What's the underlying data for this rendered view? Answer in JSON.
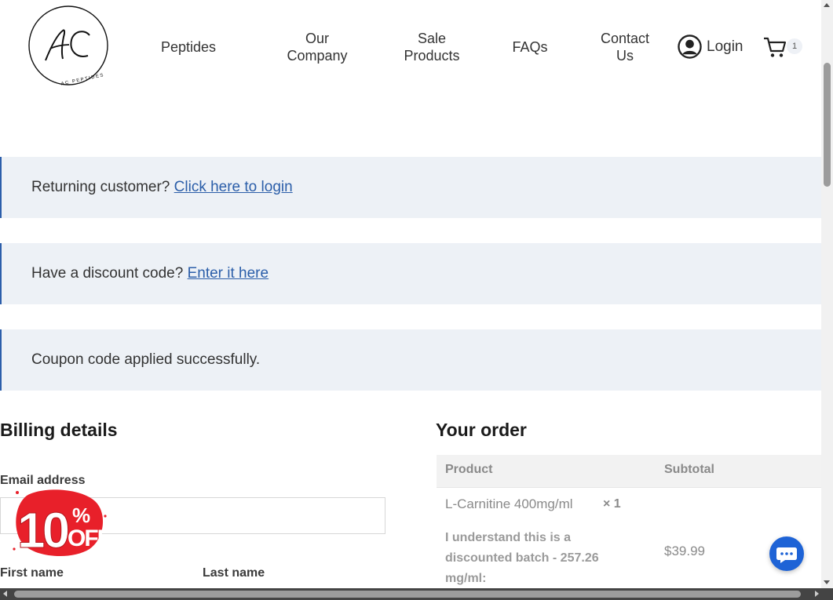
{
  "header": {
    "logo_text": "AC",
    "logo_ring_text": "AC PEPTIDES",
    "nav": [
      {
        "line1": "Peptides",
        "line2": ""
      },
      {
        "line1": "Our",
        "line2": "Company"
      },
      {
        "line1": "Sale",
        "line2": "Products"
      },
      {
        "line1": "FAQs",
        "line2": ""
      },
      {
        "line1": "Contact",
        "line2": "Us"
      }
    ],
    "login_label": "Login",
    "cart_count": "1"
  },
  "notices": {
    "returning_text": "Returning customer?",
    "returning_link": "Click here to login",
    "discount_text": "Have a discount code?",
    "discount_link": "Enter it here",
    "coupon_text": "Coupon code applied successfully."
  },
  "billing": {
    "title": "Billing details",
    "email_label": "Email address",
    "email_value": "",
    "first_name_label": "First name",
    "last_name_label": "Last name",
    "promo_badge": "10% OFF"
  },
  "order": {
    "title": "Your order",
    "col_product": "Product",
    "col_subtotal": "Subtotal",
    "item_name": "L-Carnitine 400mg/ml",
    "item_qty": "× 1",
    "item_note_1": "I understand this is a",
    "item_note_2": "discounted batch - 257.26",
    "item_note_3": "mg/ml:",
    "item_subtotal": "$39.99"
  },
  "icons": {
    "user": "user-circle-icon",
    "cart": "cart-icon",
    "chat": "chat-bubble-icon"
  },
  "colors": {
    "link": "#2b5ea9",
    "notice_bg": "#edf1f6",
    "chat_button": "#1e63d6",
    "badge_red": "#e8202a"
  }
}
